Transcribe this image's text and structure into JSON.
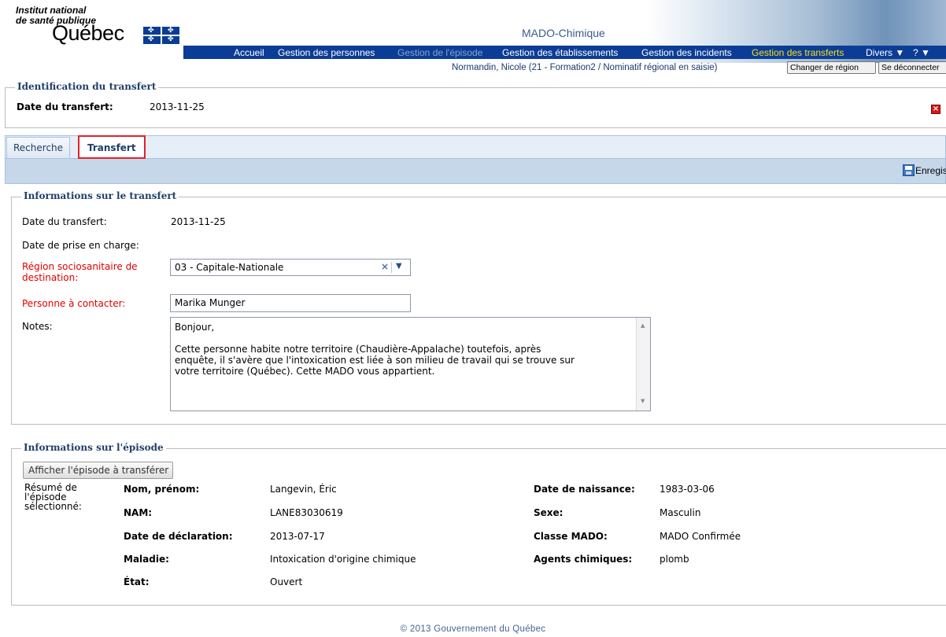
{
  "header": {
    "org_line1": "Institut national",
    "org_line2": "de santé publique",
    "org_quebec": "Québec",
    "app_title": "MADO-Chimique",
    "nav": [
      {
        "label": "Accueil",
        "state": "normal"
      },
      {
        "label": "Gestion des personnes",
        "state": "normal"
      },
      {
        "label": "Gestion de l'épisode",
        "state": "disabled"
      },
      {
        "label": "Gestion des établissements",
        "state": "normal"
      },
      {
        "label": "Gestion des incidents",
        "state": "normal"
      },
      {
        "label": "Gestion des transferts",
        "state": "active"
      },
      {
        "label": "Divers ▼",
        "state": "normal"
      },
      {
        "label": "? ▼",
        "state": "normal"
      }
    ],
    "user_info": "Normandin, Nicole (21 - Formation2 / Nominatif régional en saisie)",
    "change_region_label": "Changer de région",
    "logout_label": "Se déconnecter"
  },
  "identification": {
    "legend": "Identification du transfert",
    "date_label": "Date du transfert:",
    "date_value": "2013-11-25"
  },
  "tabs": [
    {
      "label": "Recherche",
      "active": false
    },
    {
      "label": "Transfert",
      "active": true
    }
  ],
  "toolbar": {
    "save_label": "Enregistrer"
  },
  "transfer_info": {
    "legend": "Informations sur le transfert",
    "date_label": "Date du transfert:",
    "date_value": "2013-11-25",
    "takeover_label": "Date de prise en charge:",
    "takeover_value": "",
    "region_label_line1": "Région sociosanitaire de",
    "region_label_line2": "destination:",
    "region_value": "03 - Capitale-Nationale",
    "contact_label": "Personne à contacter:",
    "contact_value": "Marika Munger",
    "notes_label": "Notes:",
    "notes_value": "Bonjour,\n\nCette personne habite notre territoire (Chaudière-Appalache) toutefois, après\nenquête, il s'avère que l'intoxication est liée à son milieu de travail qui se trouve sur\nvotre territoire (Québec). Cette MADO vous appartient."
  },
  "episode_info": {
    "legend": "Informations sur l'épisode",
    "show_button_label": "Afficher l'épisode à transférer",
    "summary_label_line1": "Résumé de",
    "summary_label_line2": "l'épisode",
    "summary_label_line3": "sélectionné:",
    "left_fields": [
      {
        "label": "Nom, prénom:",
        "value": "Langevin, Éric"
      },
      {
        "label": "NAM:",
        "value": "LANE83030619"
      },
      {
        "label": "Date de déclaration:",
        "value": "2013-07-17"
      },
      {
        "label": "Maladie:",
        "value": "Intoxication d'origine chimique"
      },
      {
        "label": "État:",
        "value": "Ouvert"
      }
    ],
    "right_fields": [
      {
        "label": "Date de naissance:",
        "value": "1983-03-06"
      },
      {
        "label": "Sexe:",
        "value": "Masculin"
      },
      {
        "label": "Classe MADO:",
        "value": "MADO Confirmée"
      },
      {
        "label": "Agents chimiques:",
        "value": "plomb"
      }
    ]
  },
  "footer": {
    "copyright": "© 2013 Gouvernement du Québec"
  },
  "colors": {
    "nav_bg": "#0c3d96",
    "nav_active": "#f4e11b",
    "legend": "#1f3f6a",
    "required_label": "#e00000",
    "tab_highlight": "#e0232a"
  }
}
